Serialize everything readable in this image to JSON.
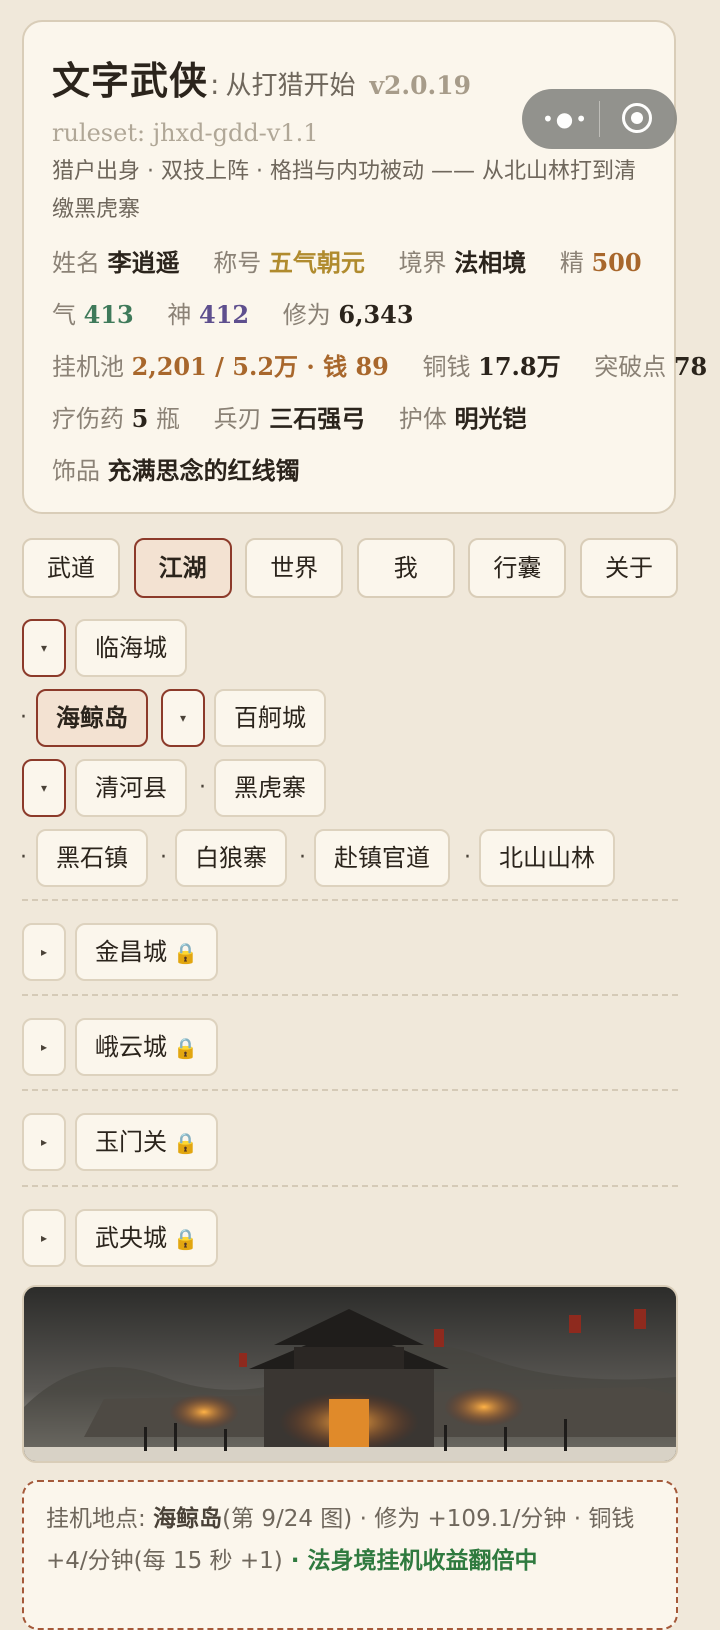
{
  "header": {
    "title": "文字武侠",
    "colon": ":",
    "subtitle": "从打猎开始",
    "version": "v2.0.19",
    "ruleset": "ruleset: jhxd-gdd-v1.1",
    "description": "猎户出身 · 双技上阵 · 格挡与内功被动 —— 从北山林打到清缴黑虎寨"
  },
  "stats": {
    "name_label": "姓名",
    "name": "李逍遥",
    "title_label": "称号",
    "title": "五气朝元",
    "realm_label": "境界",
    "realm": "法相境",
    "jing_label": "精",
    "jing": "500",
    "qi_label": "气",
    "qi": "413",
    "shen_label": "神",
    "shen": "412",
    "xiuwei_label": "修为",
    "xiuwei": "6,343",
    "pool_label": "挂机池",
    "pool": "2,201 / 5.2万 · 钱 89",
    "copper_label": "铜钱",
    "copper": "17.8万",
    "breakthrough_label": "突破点",
    "breakthrough": "78",
    "potion_label": "疗伤药",
    "potion": "5",
    "potion_unit": "瓶",
    "weapon_label": "兵刃",
    "weapon": "三石强弓",
    "armor_label": "护体",
    "armor": "明光铠",
    "accessory_label": "饰品",
    "accessory": "充满思念的红线镯"
  },
  "capsule": {
    "menu_icon": "more-dots-icon",
    "close_icon": "target-circle-icon"
  },
  "tabs": [
    "武道",
    "江湖",
    "世界",
    "我",
    "行囊",
    "关于"
  ],
  "active_tab": "江湖",
  "map": {
    "toggle_open": "▾",
    "toggle_closed": "▸",
    "sep": "·",
    "lock": "🔒",
    "row1": {
      "city": "临海城"
    },
    "row2": {
      "selected": "海鲸岛",
      "city": "百舸城"
    },
    "row3": {
      "county": "清河县",
      "place": "黑虎寨"
    },
    "row4": [
      "黑石镇",
      "白狼寨",
      "赴镇官道",
      "北山山林"
    ],
    "locked": [
      "金昌城",
      "峨云城",
      "玉门关",
      "武央城"
    ]
  },
  "status": {
    "label": "挂机地点:",
    "place": "海鲸岛",
    "map_index": "(第 9/24 图)",
    "rate": " · 修为 +109.1/分钟 · 铜钱 +4/分钟(每 15 秒 +1)",
    "bonus": " · 法身境挂机收益翻倍中"
  },
  "colors": {
    "background": "#f0e8da",
    "card": "#fbf6ec",
    "accent_border": "#8c3a2a",
    "gold": "#b08b2e",
    "green": "#3f7a5a",
    "purple": "#5e4f8e"
  }
}
